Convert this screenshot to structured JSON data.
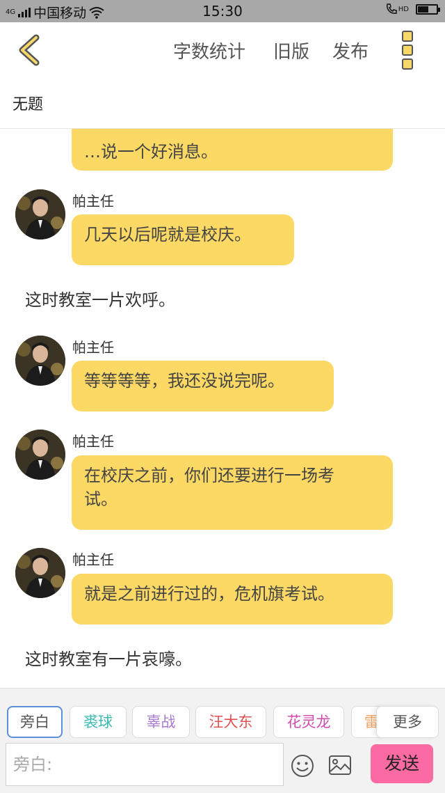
{
  "status_bar": {
    "network": "4G",
    "carrier": "中国移动",
    "time": "15:30",
    "call_badge": "HD",
    "battery_level": 0.55
  },
  "top_bar": {
    "word_count_label": "字数统计",
    "old_version_label": "旧版",
    "publish_label": "发布"
  },
  "story_title": "无题",
  "messages": [
    {
      "type": "bubble",
      "text_line1": "…说一个好消息。"
    },
    {
      "type": "speaker",
      "name": "帕主任",
      "text": "几天以后呢就是校庆。"
    },
    {
      "type": "narration",
      "text": "这时教室一片欢呼。"
    },
    {
      "type": "speaker",
      "name": "帕主任",
      "text": "等等等等，我还没说完呢。"
    },
    {
      "type": "speaker",
      "name": "帕主任",
      "line1": "在校庆之前，你们还要进行一场考",
      "line2": "试。"
    },
    {
      "type": "speaker",
      "name": "帕主任",
      "text": "就是之前进行过的，危机旗考试。"
    },
    {
      "type": "narration",
      "text": "这时教室有一片哀嚎。"
    }
  ],
  "characters": [
    {
      "label": "旁白",
      "color": "#555555"
    },
    {
      "label": "裘球",
      "color": "#3cb8b0"
    },
    {
      "label": "辜战",
      "color": "#a77ad0"
    },
    {
      "label": "汪大东",
      "color": "#e05252"
    },
    {
      "label": "花灵龙",
      "color": "#d04ab0"
    },
    {
      "label": "雷",
      "color": "#f0a060"
    }
  ],
  "more_label": "更多",
  "input": {
    "placeholder": "旁白:"
  },
  "send_label": "发送",
  "colors": {
    "bubble": "#fbd964",
    "send_button": "#fb6aa3",
    "status_bar": "#a8a8a8"
  }
}
